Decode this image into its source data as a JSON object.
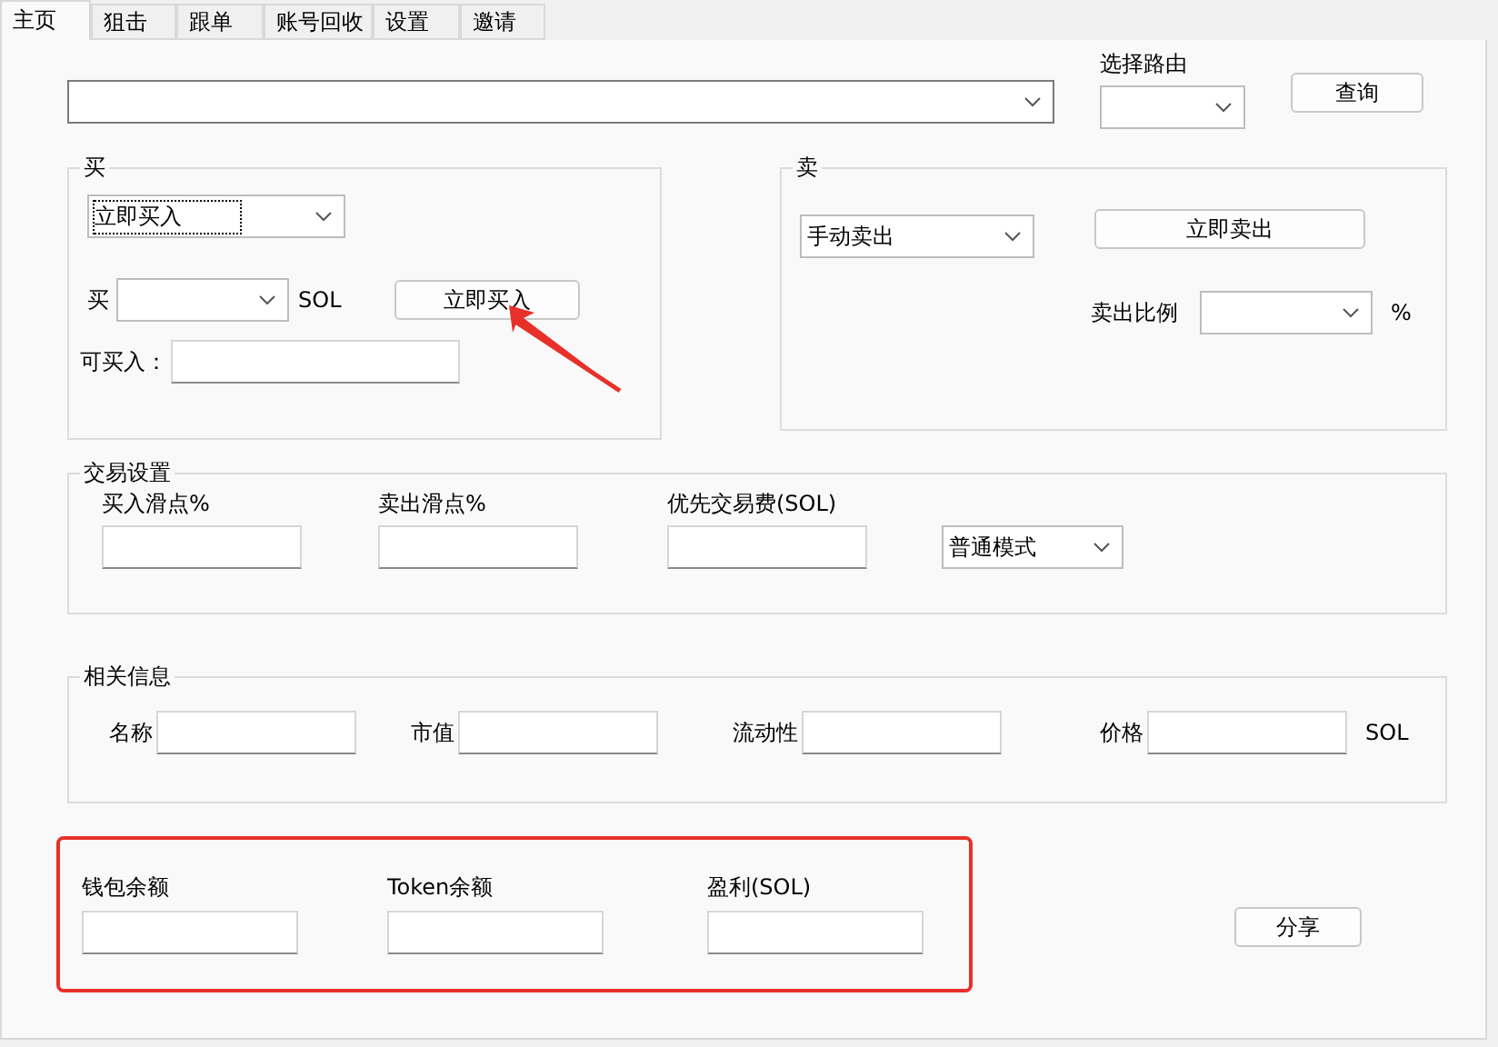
{
  "tabs": [
    {
      "label": "主页",
      "selected": true
    },
    {
      "label": "狙击",
      "selected": false
    },
    {
      "label": "跟单",
      "selected": false
    },
    {
      "label": "账号回收",
      "selected": false
    },
    {
      "label": "设置",
      "selected": false
    },
    {
      "label": "邀请",
      "selected": false
    }
  ],
  "route_label": "选择路由",
  "query_button": "查询",
  "buy": {
    "title": "买",
    "mode_select": "立即买入",
    "amount_label": "买",
    "amount_unit": "SOL",
    "buy_button": "立即买入",
    "available_label": "可买入："
  },
  "sell": {
    "title": "卖",
    "mode_select": "手动卖出",
    "sell_button": "立即卖出",
    "ratio_label": "卖出比例",
    "ratio_unit": "%"
  },
  "trade_settings": {
    "title": "交易设置",
    "fields": [
      "买入滑点%",
      "卖出滑点%",
      "优先交易费(SOL)"
    ],
    "mode_select": "普通模式"
  },
  "info": {
    "title": "相关信息",
    "fields": [
      "名称",
      "市值",
      "流动性",
      "价格"
    ],
    "unit": "SOL"
  },
  "balances": {
    "highlighted": true,
    "fields": [
      "钱包余额",
      "Token余额",
      "盈利(SOL)"
    ],
    "share_button": "分享"
  },
  "annotations": [
    {
      "kind": "arrow"
    }
  ]
}
